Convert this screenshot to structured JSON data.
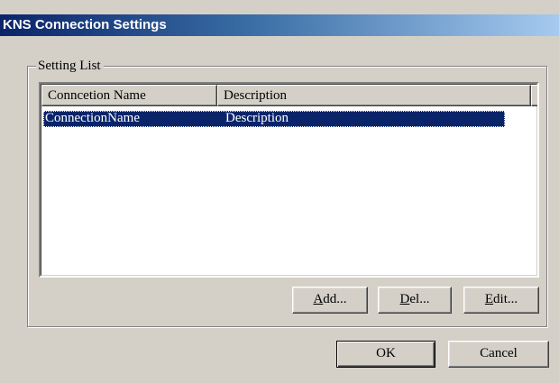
{
  "window": {
    "title": "KNS Connection Settings"
  },
  "setting_list": {
    "legend": "Setting List",
    "columns": [
      "Conncetion Name",
      "Description",
      ""
    ],
    "rows": [
      {
        "connection_name": "ConnectionName",
        "description": "Description",
        "selected": true
      }
    ]
  },
  "buttons": {
    "add": {
      "mnemonic": "A",
      "rest": "dd..."
    },
    "del": {
      "mnemonic": "D",
      "rest": "el..."
    },
    "edit": {
      "mnemonic": "E",
      "rest": "dit..."
    },
    "ok": "OK",
    "cancel": "Cancel"
  },
  "colors": {
    "titlebar_start": "#0a246a",
    "titlebar_end": "#a6caf0",
    "selection": "#0a246a",
    "dialog_face": "#d4d0c8"
  }
}
